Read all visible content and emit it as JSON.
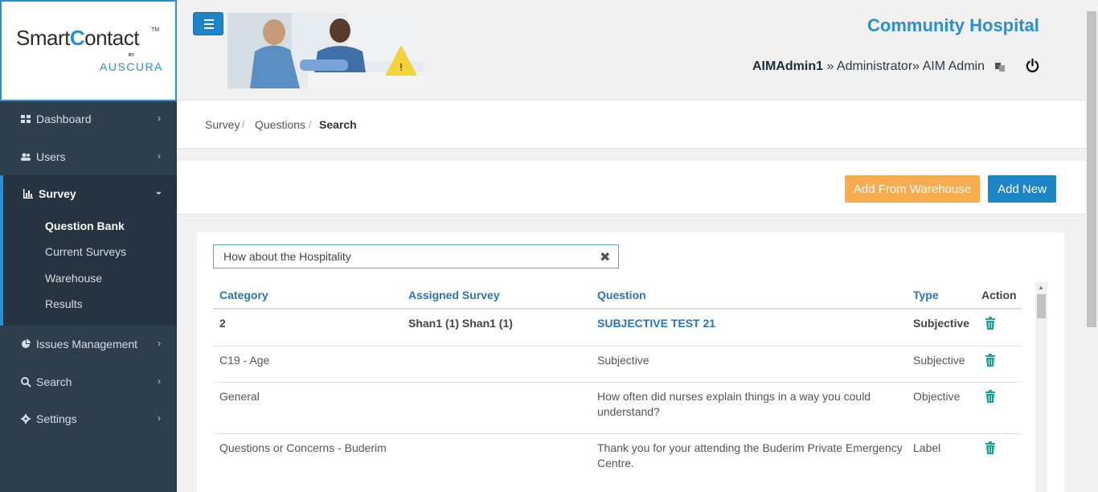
{
  "brand": {
    "name_pre": "Smart",
    "name_c": "C",
    "name_post": "ontact",
    "tm": "TM",
    "by": "BY",
    "sub": "AUSCURA"
  },
  "sidebar": {
    "items": [
      {
        "label": "Dashboard",
        "icon": "dashboard-icon"
      },
      {
        "label": "Users",
        "icon": "users-icon"
      },
      {
        "label": "Survey",
        "icon": "bar-chart-icon"
      },
      {
        "label": "Issues Management",
        "icon": "pie-chart-icon"
      },
      {
        "label": "Search",
        "icon": "search-icon"
      },
      {
        "label": "Settings",
        "icon": "gear-icon"
      }
    ],
    "survey_sub": [
      "Question Bank",
      "Current Surveys",
      "Warehouse",
      "Results"
    ]
  },
  "header": {
    "hospital": "Community Hospital",
    "user": "AIMAdmin1",
    "role_line": " » Administrator» AIM Admin"
  },
  "breadcrumb": [
    "Survey",
    "Questions",
    "Search"
  ],
  "actions": {
    "add_from_warehouse": "Add From Warehouse",
    "add_new": "Add New"
  },
  "search": {
    "value": "How about the Hospitality"
  },
  "table": {
    "headers": [
      "Category",
      "Assigned Survey",
      "Question",
      "Type",
      "Action"
    ],
    "rows": [
      {
        "category": "2",
        "assigned": "Shan1 (1) Shan1 (1)",
        "question": "SUBJECTIVE TEST 21",
        "question2": "",
        "type": "Subjective"
      },
      {
        "category": "C19 - Age",
        "assigned": "",
        "question": "Subjective",
        "question2": "",
        "type": "Subjective"
      },
      {
        "category": "General",
        "assigned": "",
        "question": "How often did nurses explain things in a way you could",
        "question2": "understand?",
        "type": "Objective"
      },
      {
        "category": "Questions or Concerns - Buderim",
        "assigned": "",
        "question": "Thank you for your attending the Buderim Private Emergency",
        "question2": "Centre.",
        "type": "Label"
      }
    ]
  },
  "colors": {
    "accent": "#2a8fd0",
    "sidebar": "#2f3e4d",
    "warning": "#f7ad4f",
    "trash": "#1aa39a"
  }
}
